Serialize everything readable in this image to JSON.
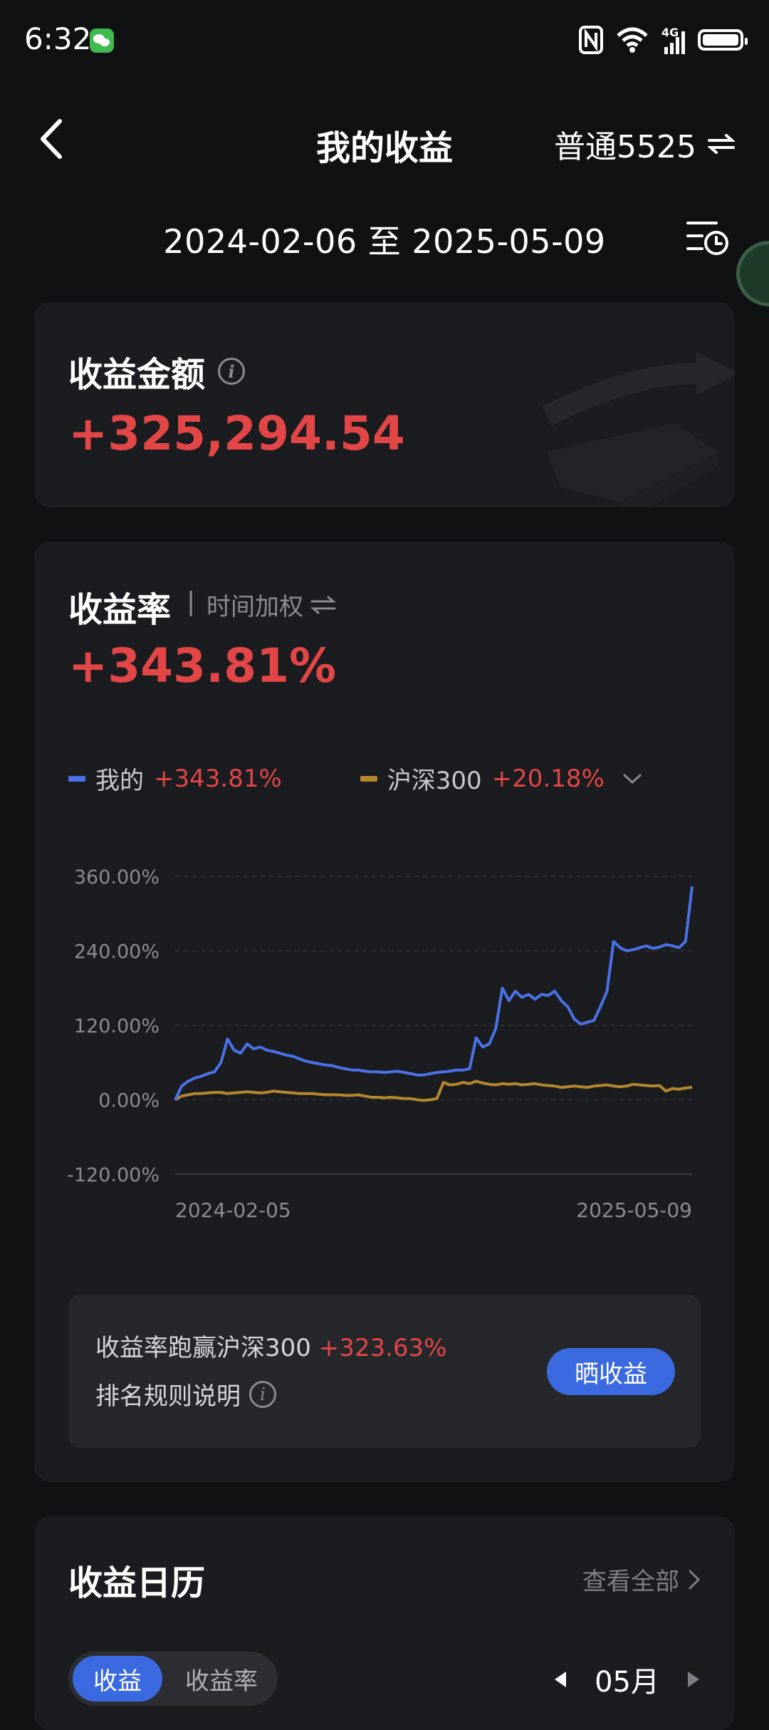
{
  "status_bar": {
    "time": "6:32",
    "icons": [
      "wechat-notification-icon",
      "nfc-icon",
      "wifi-icon",
      "signal-4g-icon",
      "battery-icon"
    ],
    "network": "4G"
  },
  "header": {
    "title": "我的收益",
    "account": "普通5525",
    "back_icon": "back-arrow-icon",
    "switch_icon": "swap-arrows-icon"
  },
  "date_range": {
    "text": "2024-02-06 至 2025-05-09",
    "history_icon": "history-list-icon"
  },
  "amount_card": {
    "label": "收益金额",
    "info_icon": "info-icon",
    "value": "+325,294.54"
  },
  "rate_card": {
    "label": "收益率",
    "separator": "|",
    "method": "时间加权",
    "value": "+343.81%",
    "legend": [
      {
        "name": "我的",
        "value": "+343.81%",
        "color": "#4a72e8"
      },
      {
        "name": "沪深300",
        "value": "+20.18%",
        "color": "#b5862e"
      }
    ],
    "compare_text": "收益率跑赢沪深300",
    "compare_value": "+323.63%",
    "rules_text": "排名规则说明",
    "share_button": "晒收益"
  },
  "chart_data": {
    "type": "line",
    "ylim": [
      -120,
      360
    ],
    "yticks": [
      "360.00%",
      "240.00%",
      "120.00%",
      "0.00%",
      "-120.00%"
    ],
    "ytick_values": [
      360,
      240,
      120,
      0,
      -120
    ],
    "x_start_label": "2024-02-05",
    "x_end_label": "2025-05-09",
    "grid": true,
    "series": [
      {
        "name": "我的",
        "color": "#4a72e8",
        "values": [
          0,
          22,
          30,
          35,
          38,
          42,
          45,
          60,
          98,
          80,
          75,
          90,
          82,
          85,
          80,
          78,
          75,
          72,
          70,
          66,
          62,
          60,
          58,
          56,
          55,
          52,
          50,
          48,
          48,
          46,
          45,
          45,
          44,
          45,
          46,
          44,
          42,
          40,
          40,
          42,
          44,
          45,
          46,
          48,
          48,
          50,
          100,
          85,
          90,
          115,
          180,
          160,
          175,
          165,
          170,
          162,
          170,
          168,
          175,
          160,
          150,
          130,
          122,
          125,
          128,
          150,
          175,
          255,
          245,
          240,
          242,
          245,
          248,
          244,
          246,
          250,
          248,
          245,
          255,
          343.81
        ]
      },
      {
        "name": "沪深300",
        "color": "#b5862e",
        "values": [
          0,
          6,
          8,
          10,
          10,
          11,
          12,
          12,
          10,
          11,
          12,
          13,
          12,
          11,
          12,
          14,
          13,
          12,
          11,
          10,
          10,
          10,
          9,
          8,
          8,
          8,
          7,
          7,
          8,
          6,
          4,
          4,
          3,
          4,
          3,
          2,
          2,
          0,
          -1,
          0,
          2,
          28,
          24,
          25,
          28,
          26,
          30,
          27,
          25,
          24,
          26,
          25,
          26,
          24,
          25,
          26,
          24,
          23,
          22,
          20,
          21,
          22,
          21,
          20,
          22,
          23,
          24,
          22,
          21,
          22,
          25,
          24,
          23,
          22,
          23,
          14,
          18,
          17,
          19,
          20.18
        ]
      }
    ]
  },
  "calendar_card": {
    "title": "收益日历",
    "view_all": "查看全部",
    "tabs": [
      "收益",
      "收益率"
    ],
    "active_tab": "收益",
    "month": "05月"
  }
}
